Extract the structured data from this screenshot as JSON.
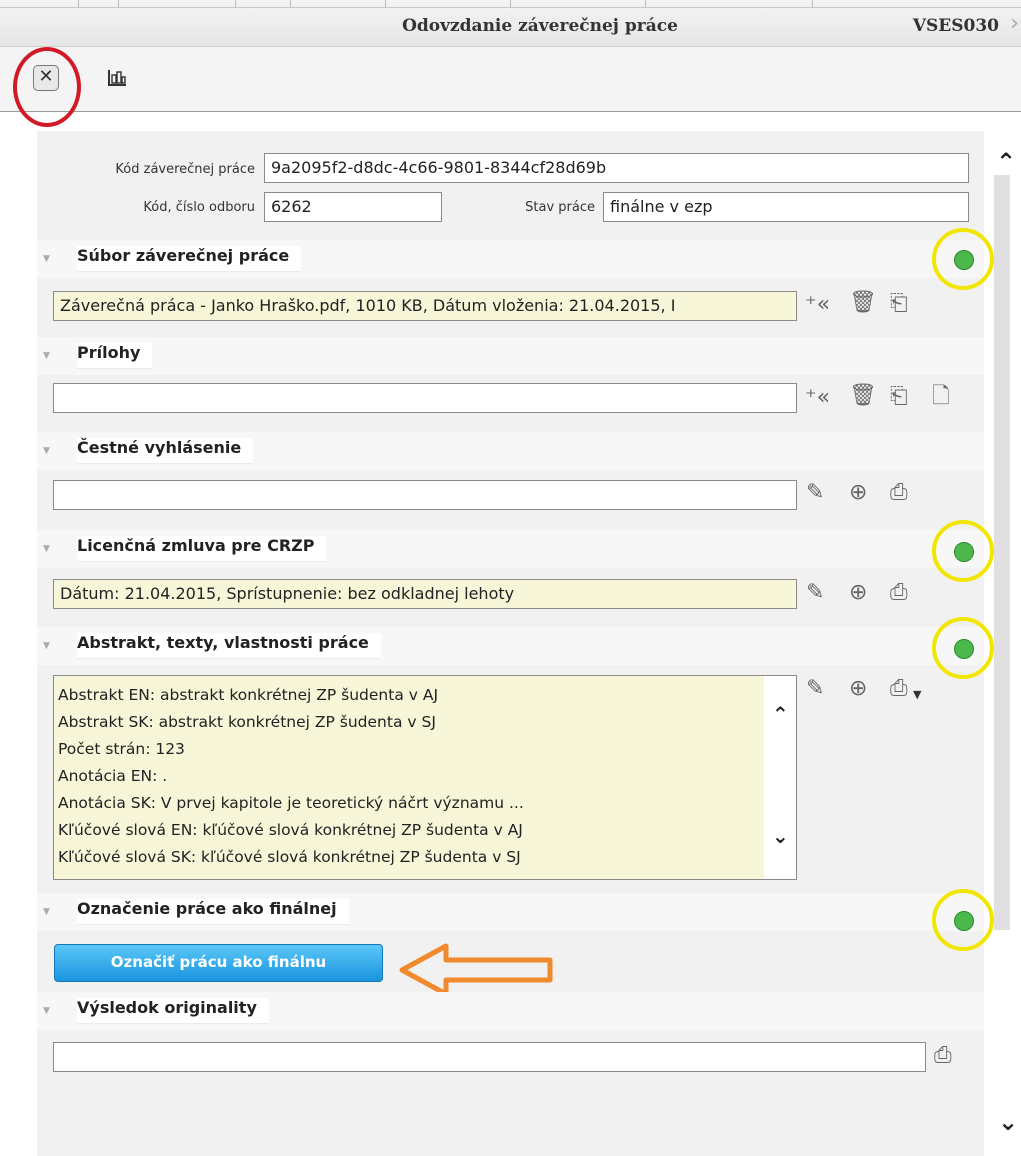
{
  "window": {
    "title": "Odovzdanie záverečnej práce",
    "form_code": "VSES030"
  },
  "toolbar": {
    "close_glyph": "✕",
    "tree_icon": "tree-icon"
  },
  "form": {
    "kod_label": "Kód záverečnej práce",
    "kod_value": "9a2095f2-d8dc-4c66-9801-8344cf28d69b",
    "odbor_label": "Kód, číslo odboru",
    "odbor_value": "6262",
    "stav_label": "Stav práce",
    "stav_value": "finálne v ezp"
  },
  "sections": {
    "subor": {
      "title": "Súbor záverečnej práce",
      "value": "Záverečná práca - Janko Hraško.pdf, 1010 KB, Dátum vloženia: 21.04.2015, I"
    },
    "prilohy": {
      "title": "Prílohy",
      "value": ""
    },
    "cestne": {
      "title": "Čestné vyhlásenie",
      "value": ""
    },
    "licencna": {
      "title": "Licenčná zmluva pre CRZP",
      "value": "Dátum: 21.04.2015, Sprístupnenie: bez odkladnej lehoty"
    },
    "abstrakt": {
      "title": "Abstrakt, texty, vlastnosti práce",
      "lines": [
        "Abstrakt EN: abstrakt konkrétnej ZP šudenta v AJ",
        "Abstrakt SK: abstrakt konkrétnej ZP šudenta v SJ",
        "Počet strán: 123",
        "Anotácia EN: .",
        "Anotácia SK: V prvej  kapitole je teoretický náčrt   významu   ...",
        "Kľúčové slová EN: kľúčové slová konkrétnej ZP šudenta v AJ",
        "Kľúčové slová SK: kľúčové slová konkrétnej ZP šudenta v SJ"
      ]
    },
    "oznacenie": {
      "title": "Označenie práce ako finálnej",
      "button_label": "Označiť prácu ako finálnu"
    },
    "vysledok": {
      "title": "Výsledok originality",
      "value": ""
    }
  },
  "icons": {
    "add": "add-icon",
    "delete": "trash-icon",
    "open": "open-file-icon",
    "new": "new-file-icon",
    "edit": "pencil-icon",
    "zoom": "zoom-icon",
    "print": "printer-icon",
    "status": "smiley-icon"
  },
  "colors": {
    "filled_field": "#f8f6d8",
    "button": "#1a94de",
    "status_ok": "#4cb84c",
    "annotation_red": "#d11a26",
    "annotation_yellow": "#f2e600",
    "annotation_orange": "#f08a2c"
  }
}
